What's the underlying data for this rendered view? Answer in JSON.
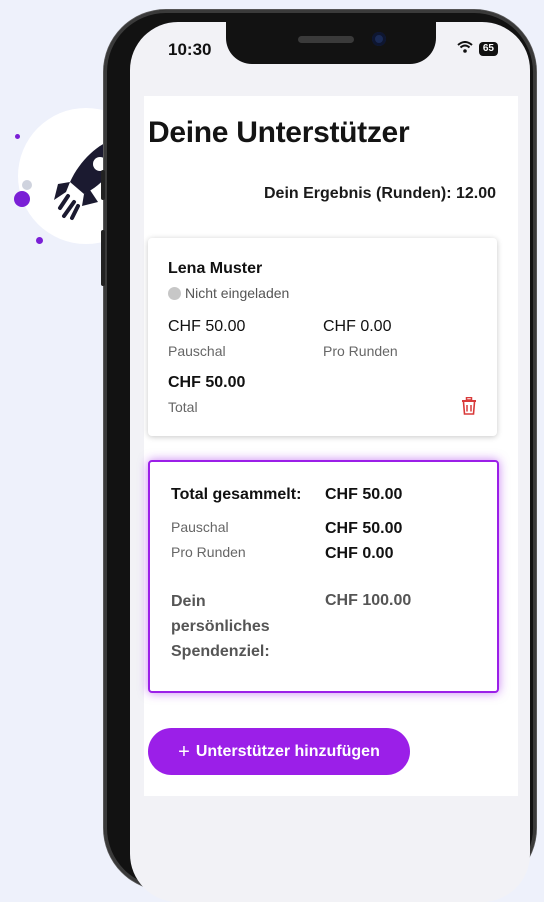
{
  "status_bar": {
    "time": "10:30",
    "battery": "65"
  },
  "page": {
    "title": "Deine Unterstützer",
    "result_label": "Dein Ergebnis (Runden): 12.00"
  },
  "supporter": {
    "name": "Lena Muster",
    "status": "Nicht eingeladen",
    "flat_amount": "CHF 50.00",
    "flat_label": "Pauschal",
    "per_round_amount": "CHF 0.00",
    "per_round_label": "Pro Runden",
    "total_amount": "CHF 50.00",
    "total_label": "Total"
  },
  "summary": {
    "total_label": "Total gesammelt:",
    "total_value": "CHF 50.00",
    "flat_label": "Pauschal",
    "flat_value": "CHF 50.00",
    "per_round_label": "Pro Runden",
    "per_round_value": "CHF 0.00",
    "goal_label": "Dein persönliches Spendenziel:",
    "goal_value": "CHF 100.00"
  },
  "add_button": {
    "icon": "+",
    "label": "Unterstützer hinzufügen"
  },
  "colors": {
    "accent": "#9b1fe8",
    "rocket": "#1b1a30",
    "delete": "#d93a3a"
  }
}
